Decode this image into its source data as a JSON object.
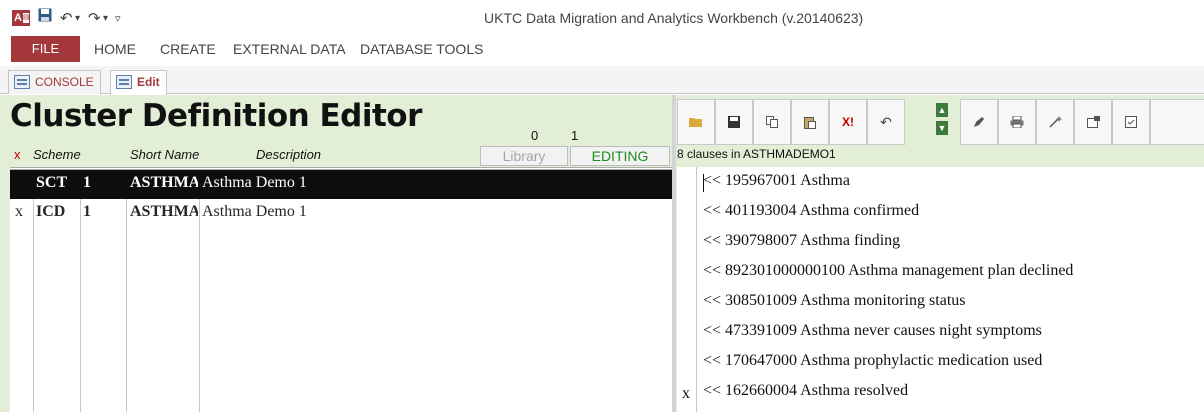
{
  "titlebar": {
    "title": "UKTC Data Migration and Analytics Workbench (v.20140623)",
    "quick_access": {
      "save_icon": "save-icon",
      "undo": "↶",
      "undo_dd": "▾",
      "redo": "↷",
      "redo_dd": "▾",
      "customize": "▿"
    }
  },
  "ribbon": {
    "file": "FILE",
    "tabs": [
      "HOME",
      "CREATE",
      "EXTERNAL DATA",
      "DATABASE TOOLS"
    ]
  },
  "object_tabs": [
    {
      "label": "CONSOLE",
      "active": false
    },
    {
      "label": "Edit",
      "active": true
    }
  ],
  "form": {
    "title": "Cluster Definition Editor",
    "counter_a": "0",
    "counter_b": "1",
    "columns": {
      "x": "x",
      "scheme": "Scheme",
      "short_name": "Short Name",
      "description": "Description"
    },
    "library_button": "Library",
    "editing_button": "EDITING",
    "rows": [
      {
        "x": "",
        "scheme": "SCT",
        "version": "1",
        "short_name": "ASTHMAD",
        "description": "Asthma Demo 1",
        "selected": true
      },
      {
        "x": "x",
        "scheme": "ICD",
        "version": "1",
        "short_name": "ASTHMAD",
        "description": "Asthma Demo 1",
        "selected": false
      }
    ]
  },
  "toolbar": {
    "buttons": [
      "open-folder-icon",
      "save-icon",
      "copy-icon",
      "paste-icon",
      "delete-icon",
      "undo-icon",
      "move-up-icon",
      "move-down-icon",
      "pencil-icon",
      "print-icon",
      "wand-icon",
      "properties-icon",
      "checklist-icon"
    ],
    "delete_label": "X!",
    "up_glyph": "▲",
    "down_glyph": "▼"
  },
  "clauses": {
    "count_text": "8 clauses in ASTHMADEMO1",
    "items": [
      {
        "x": "",
        "text": "<< 195967001 Asthma"
      },
      {
        "x": "",
        "text": "<< 401193004 Asthma confirmed"
      },
      {
        "x": "",
        "text": "<< 390798007 Asthma finding"
      },
      {
        "x": "",
        "text": "<< 892301000000100 Asthma management plan declined"
      },
      {
        "x": "",
        "text": "<< 308501009 Asthma monitoring status"
      },
      {
        "x": "",
        "text": "<< 473391009 Asthma never causes night symptoms"
      },
      {
        "x": "",
        "text": "<< 170647000 Asthma prophylactic medication used"
      },
      {
        "x": "x",
        "text": "<< 162660004 Asthma resolved"
      }
    ]
  },
  "colors": {
    "access_red": "#a4373a",
    "form_bg": "#e3eed6",
    "editing_green": "#218b21"
  }
}
